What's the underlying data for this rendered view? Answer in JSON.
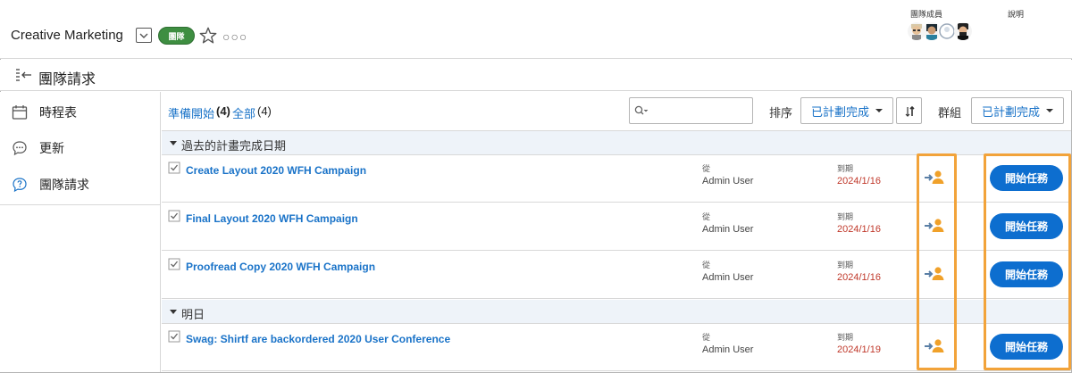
{
  "header": {
    "team_name": "Creative Marketing",
    "team_badge": "團隊",
    "more": "○○○",
    "members_label": "團隊成員",
    "help_label": "說明",
    "avatars": [
      "avatar-1",
      "avatar-2",
      "avatar-3",
      "avatar-4"
    ]
  },
  "titlebar": {
    "title": "團隊請求"
  },
  "sidebar": {
    "items": [
      {
        "label": "時程表",
        "icon": "calendar-icon"
      },
      {
        "label": "更新",
        "icon": "chat-bubble-icon"
      },
      {
        "label": "團隊請求",
        "icon": "question-bubble-icon"
      }
    ]
  },
  "toolbar": {
    "filter_ready": "準備開始",
    "filter_ready_count": "(4)",
    "filter_all": "全部",
    "filter_all_count": "(4)",
    "search_placeholder": "",
    "sort_label": "排序",
    "sort_value": "已計劃完成",
    "group_label": "群組",
    "group_value": "已計劃完成"
  },
  "sections": [
    {
      "title": "過去的計畫完成日期",
      "rows": [
        {
          "task": "Create Layout 2020 WFH Campaign",
          "from_label": "從",
          "from": "Admin User",
          "due_label": "到期",
          "due": "2024/1/16",
          "action": "開始任務"
        },
        {
          "task": "Final Layout 2020 WFH Campaign",
          "from_label": "從",
          "from": "Admin User",
          "due_label": "到期",
          "due": "2024/1/16",
          "action": "開始任務"
        },
        {
          "task": "Proofread Copy 2020 WFH Campaign",
          "from_label": "從",
          "from": "Admin User",
          "due_label": "到期",
          "due": "2024/1/16",
          "action": "開始任務"
        }
      ]
    },
    {
      "title": "明日",
      "rows": [
        {
          "task": "Swag: Shirtf are backordered 2020 User Conference",
          "from_label": "從",
          "from": "Admin User",
          "due_label": "到期",
          "due": "2024/1/19",
          "action": "開始任務"
        }
      ]
    }
  ],
  "colors": {
    "accent": "#1a73c8",
    "button": "#0d6ecf",
    "badge": "#3e8e41",
    "due": "#c0392b",
    "highlight": "#f2a33a"
  }
}
